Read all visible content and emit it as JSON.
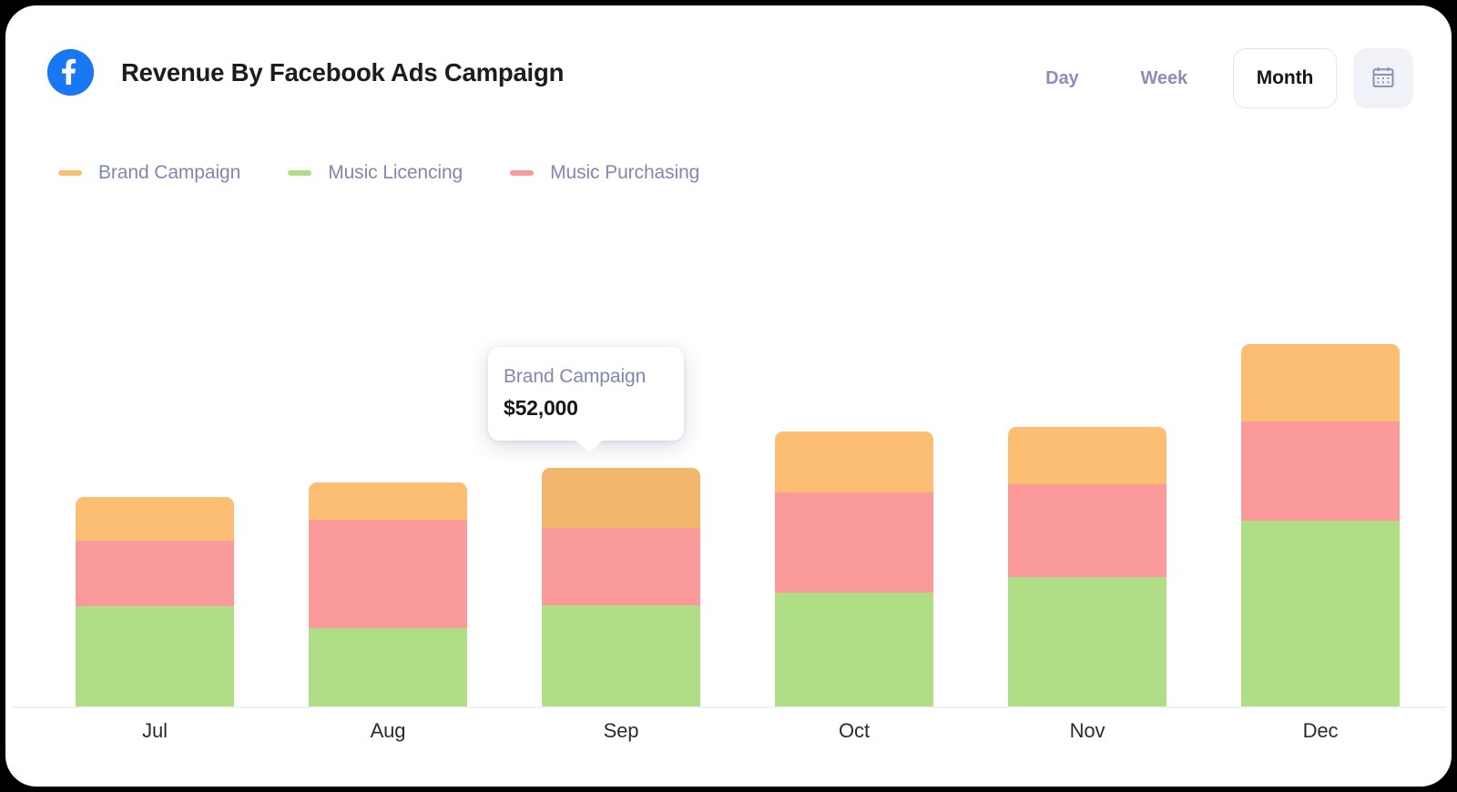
{
  "header": {
    "logo_icon": "facebook-logo-icon",
    "title": "Revenue By Facebook Ads Campaign",
    "controls": {
      "day_label": "Day",
      "week_label": "Week",
      "month_label": "Month",
      "active_range": "Month",
      "calendar_icon": "calendar-icon"
    }
  },
  "legend": [
    {
      "label": "Brand Campaign",
      "color": "#FBBE72"
    },
    {
      "label": "Music Licencing",
      "color": "#AFDE87"
    },
    {
      "label": "Music Purchasing",
      "color": "#FB9A9A"
    }
  ],
  "tooltip": {
    "series": "Brand Campaign",
    "value": "$52,000",
    "category": "Sep"
  },
  "colors": {
    "brand_campaign": "#FBBE72",
    "music_licencing": "#AFDE87",
    "music_purchasing": "#FB9A9A",
    "facebook_blue": "#1877F2",
    "muted_text": "#8287b1",
    "dark_text": "#16161c",
    "card_bg": "#ffffff",
    "page_bg": "#000000"
  },
  "chart_data": {
    "type": "bar",
    "stacked": true,
    "title": "Revenue By Facebook Ads Campaign",
    "xlabel": "",
    "ylabel": "",
    "grid": false,
    "legend_position": "top-left",
    "categories": [
      "Jul",
      "Aug",
      "Sep",
      "Oct",
      "Nov",
      "Dec"
    ],
    "series": [
      {
        "name": "Music Licencing",
        "color": "#AFDE87",
        "values": [
          110,
          86,
          111,
          125,
          142,
          204
        ]
      },
      {
        "name": "Music Purchasing",
        "color": "#FB9A9A",
        "values": [
          72,
          119,
          85,
          110,
          102,
          109
        ]
      },
      {
        "name": "Brand Campaign",
        "color": "#FBBE72",
        "values": [
          48,
          41,
          66,
          67,
          63,
          85
        ]
      }
    ],
    "annotations": [
      {
        "category": "Sep",
        "series": "Brand Campaign",
        "label": "$52,000"
      }
    ]
  },
  "x_axis": {
    "ticks": [
      "Jul",
      "Aug",
      "Sep",
      "Oct",
      "Nov",
      "Dec"
    ]
  }
}
